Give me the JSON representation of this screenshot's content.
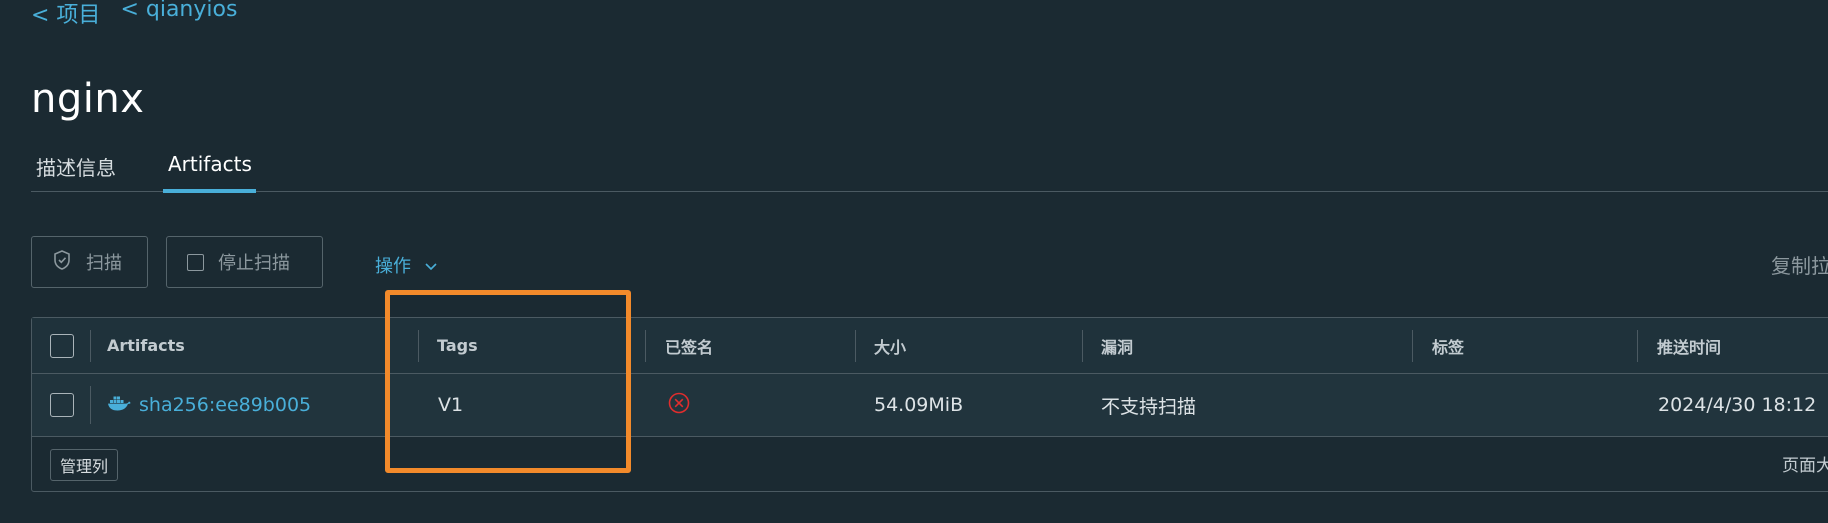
{
  "breadcrumbs": [
    "< 项目",
    "< qianyios"
  ],
  "title": "nginx",
  "tabs": [
    "描述信息",
    "Artifacts"
  ],
  "active_tab": "Artifacts",
  "toolbar": {
    "scan_label": "扫描",
    "stop_scan_label": "停止扫描",
    "actions_label": "操作",
    "copy_label": "复制拉"
  },
  "table": {
    "columns": [
      "Artifacts",
      "Tags",
      "已签名",
      "大小",
      "漏洞",
      "标签",
      "推送时间"
    ],
    "rows": [
      {
        "artifact": "sha256:ee89b005",
        "tags": "V1",
        "size": "54.09MiB",
        "vulnerabilities": "不支持扫描",
        "labels": "",
        "push_time": "2024/4/30 18:12"
      }
    ],
    "manage_columns_label": "管理列",
    "page_size_label": "页面大"
  },
  "colors": {
    "accent": "#49afd9",
    "highlight": "#f28a2b",
    "error": "#e02d2d"
  }
}
